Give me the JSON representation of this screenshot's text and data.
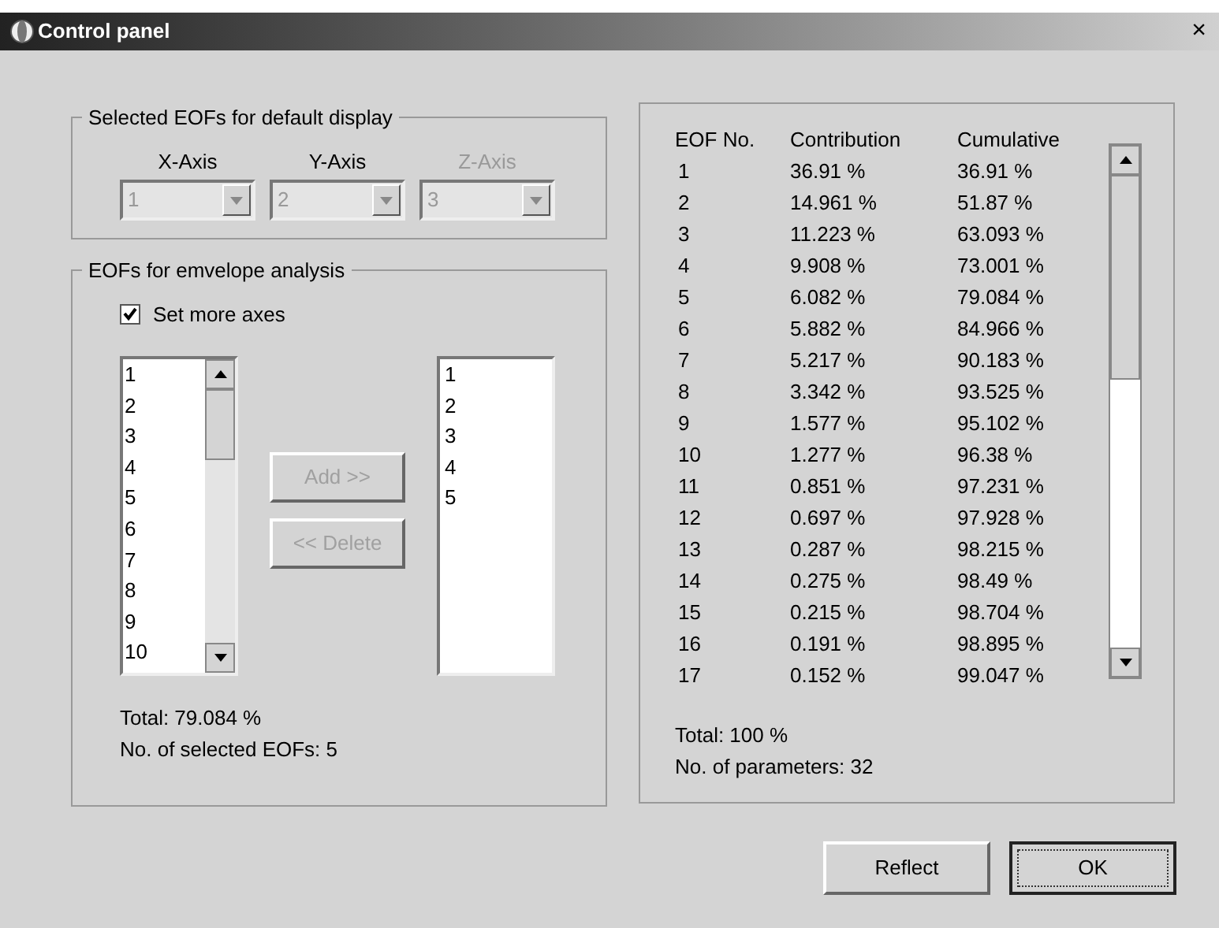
{
  "window": {
    "title": "Control panel",
    "close": "×"
  },
  "display_group": {
    "legend": "Selected EOFs for default display",
    "axes": [
      {
        "label": "X-Axis",
        "label_disabled": false,
        "value": "1",
        "disabled": true
      },
      {
        "label": "Y-Axis",
        "label_disabled": false,
        "value": "2",
        "disabled": true
      },
      {
        "label": "Z-Axis",
        "label_disabled": true,
        "value": "3",
        "disabled": true
      }
    ]
  },
  "envelope_group": {
    "legend": "EOFs for emvelope analysis",
    "set_more_axes": {
      "label": "Set more axes",
      "checked": true
    },
    "available_list": {
      "items": [
        "1",
        "2",
        "3",
        "4",
        "5",
        "6",
        "7",
        "8",
        "9",
        "10"
      ]
    },
    "buttons": [
      {
        "label": "Add >>",
        "disabled": true
      },
      {
        "label": "<< Delete",
        "disabled": true
      }
    ],
    "selected_list": {
      "items": [
        "1",
        "2",
        "3",
        "4",
        "5"
      ]
    },
    "total": "Total:  79.084 %",
    "count": "No. of selected EOFs:  5"
  },
  "eof_table": {
    "columns": [
      "EOF No.",
      "Contribution",
      "Cumulative"
    ],
    "rows": [
      [
        "1",
        "36.91 %",
        "36.91 %"
      ],
      [
        "2",
        "14.961 %",
        "51.87 %"
      ],
      [
        "3",
        "11.223 %",
        "63.093 %"
      ],
      [
        "4",
        "9.908 %",
        "73.001 %"
      ],
      [
        "5",
        "6.082 %",
        "79.084 %"
      ],
      [
        "6",
        "5.882 %",
        "84.966 %"
      ],
      [
        "7",
        "5.217 %",
        "90.183 %"
      ],
      [
        "8",
        "3.342 %",
        "93.525 %"
      ],
      [
        "9",
        "1.577 %",
        "95.102 %"
      ],
      [
        "10",
        "1.277 %",
        "96.38 %"
      ],
      [
        "11",
        "0.851 %",
        "97.231 %"
      ],
      [
        "12",
        "0.697 %",
        "97.928 %"
      ],
      [
        "13",
        "0.287 %",
        "98.215 %"
      ],
      [
        "14",
        "0.275 %",
        "98.49 %"
      ],
      [
        "15",
        "0.215 %",
        "98.704 %"
      ],
      [
        "16",
        "0.191 %",
        "98.895 %"
      ],
      [
        "17",
        "0.152 %",
        "99.047 %"
      ]
    ],
    "total": "Total:  100 %",
    "parameters": "No. of parameters:  32"
  },
  "buttons": [
    {
      "label": "Reflect",
      "focused": false
    },
    {
      "label": "OK",
      "focused": true
    }
  ]
}
